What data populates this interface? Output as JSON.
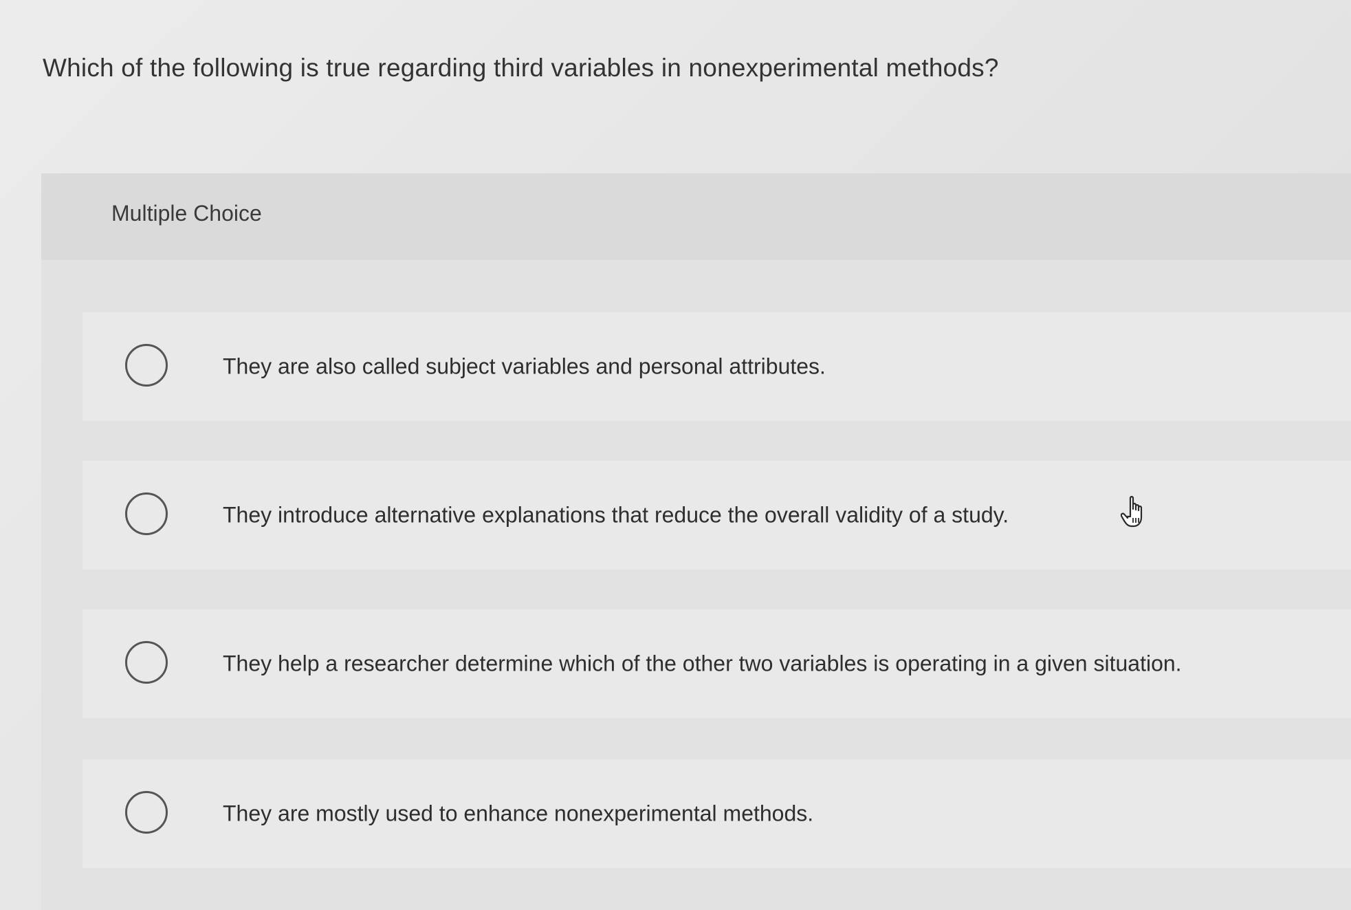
{
  "question": {
    "text": "Which of the following is true regarding third variables in nonexperimental methods?"
  },
  "panel": {
    "label": "Multiple Choice"
  },
  "options": [
    {
      "text": "They are also called subject variables and personal attributes."
    },
    {
      "text": "They introduce alternative explanations that reduce the overall validity of a study."
    },
    {
      "text": "They help a researcher determine which of the other two variables is operating in a given situation."
    },
    {
      "text": "They are mostly used to enhance nonexperimental methods."
    }
  ],
  "cursor": {
    "icon": "hand-pointer-icon"
  },
  "colors": {
    "background": "#e6e6e6",
    "panel": "#dcdcdc",
    "option": "#e9e9e9",
    "text": "#2e2e2e"
  }
}
